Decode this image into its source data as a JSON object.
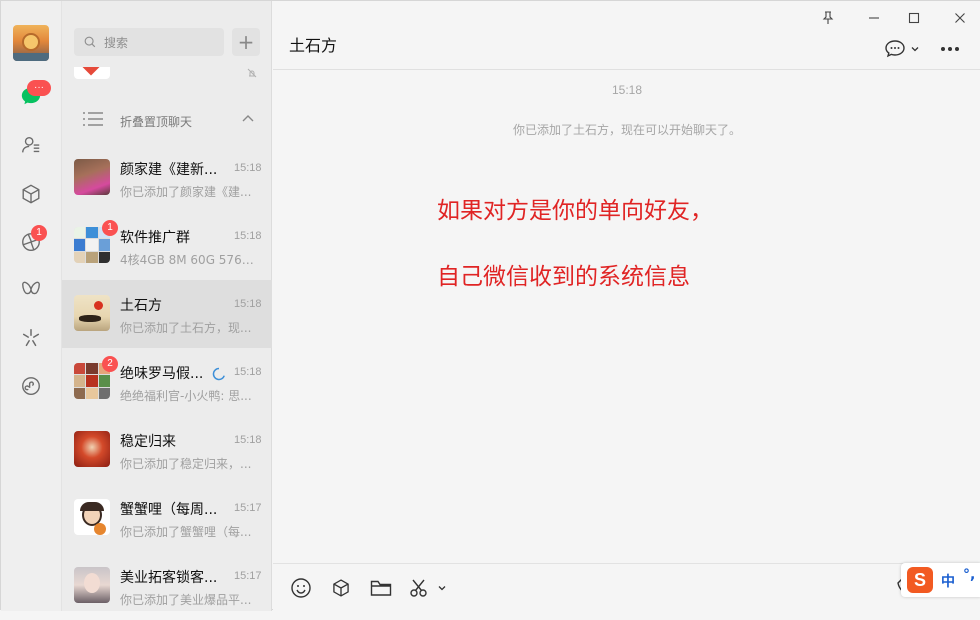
{
  "window": {
    "controls": [
      "pin-icon",
      "minimize-icon",
      "maximize-icon",
      "close-icon"
    ]
  },
  "iconbar": {
    "badges": {
      "chats": "···",
      "moments": "1"
    }
  },
  "search": {
    "placeholder": "搜索"
  },
  "fold": {
    "label": "折叠置顶聊天"
  },
  "chats": [
    {
      "name": "颜家建《建新...",
      "time": "15:18",
      "preview": "你已添加了颜家建《建...",
      "badge": "",
      "active": false
    },
    {
      "name": "软件推广群",
      "time": "15:18",
      "preview": "4核4GB 8M 60G 576元...",
      "badge": "1",
      "active": false
    },
    {
      "name": "土石方",
      "time": "15:18",
      "preview": "你已添加了土石方，现...",
      "badge": "",
      "active": true
    },
    {
      "name": "绝味罗马假...",
      "time": "15:18",
      "preview": "绝绝福利官-小火鸭: 思...",
      "badge": "2",
      "active": false
    },
    {
      "name": "稳定归来",
      "time": "15:18",
      "preview": "你已添加了稳定归来，...",
      "badge": "",
      "active": false
    },
    {
      "name": "蟹蟹哩（每周...",
      "time": "15:17",
      "preview": "你已添加了蟹蟹哩（每...",
      "badge": "",
      "active": false
    },
    {
      "name": "美业拓客锁客...",
      "time": "15:17",
      "preview": "你已添加了美业爆品平...",
      "badge": "",
      "active": false
    }
  ],
  "main": {
    "title": "土石方",
    "timestamp": "15:18",
    "system_message": "你已添加了土石方，现在可以开始聊天了。",
    "annotation_line1": "如果对方是你的单向好友，",
    "annotation_line2": "自己微信收到的系统信息"
  },
  "ime": {
    "logo": "S",
    "mode": "中",
    "punct": "°,"
  },
  "colors": {
    "accent": "#07c160",
    "badge": "#fa5151",
    "annotation": "#e02424"
  }
}
